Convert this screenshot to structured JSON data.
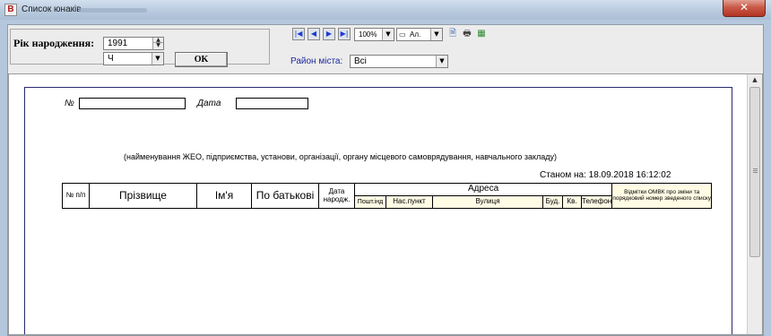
{
  "window": {
    "title": "Список юнаків",
    "app_icon_letter": "В",
    "close_glyph": "✕"
  },
  "filters": {
    "birth_year_label": "Рік народження:",
    "birth_year_value": "1991",
    "gender_value": "Ч",
    "ok_label": "OK",
    "district_label": "Район міста:",
    "district_value": "Всі"
  },
  "toolbar": {
    "first_page_icon": "first-page-icon",
    "prev_page_icon": "prev-page-icon",
    "next_page_icon": "next-page-icon",
    "last_page_icon": "last-page-icon",
    "zoom_value": "100%",
    "view_mode_value": "Ал.",
    "page_setup_icon": "page-setup-icon",
    "print_icon": "print-icon",
    "export_icon": "export-icon"
  },
  "report": {
    "number_label": "№",
    "date_label": "Дата",
    "organization_caption": "(найменування ЖЕО, підприємства, установи, організації, органу місцевого самоврядування, навчального закладу)",
    "as_of": "Станом на: 18.09.2018 16:12:02",
    "table": {
      "col_num": "№ п/п",
      "col_surname": "Прізвище",
      "col_name": "Ім'я",
      "col_patronymic": "По батькові",
      "col_birth_date": "Дата народж.",
      "col_address": "Адреса",
      "col_postcode": "Пошт.інд",
      "col_settlement": "Нас.пункт",
      "col_street": "Вулиця",
      "col_building": "Буд.",
      "col_apartment": "Кв.",
      "col_phone": "Телефон",
      "col_omvk": "Відмітки ОМВК про зміни та порядковий номер зведеного списку"
    }
  },
  "colors": {
    "header_fill": "#fffbe4",
    "district_label": "#1e2a9e",
    "nav_icon": "#1c3bd6"
  }
}
